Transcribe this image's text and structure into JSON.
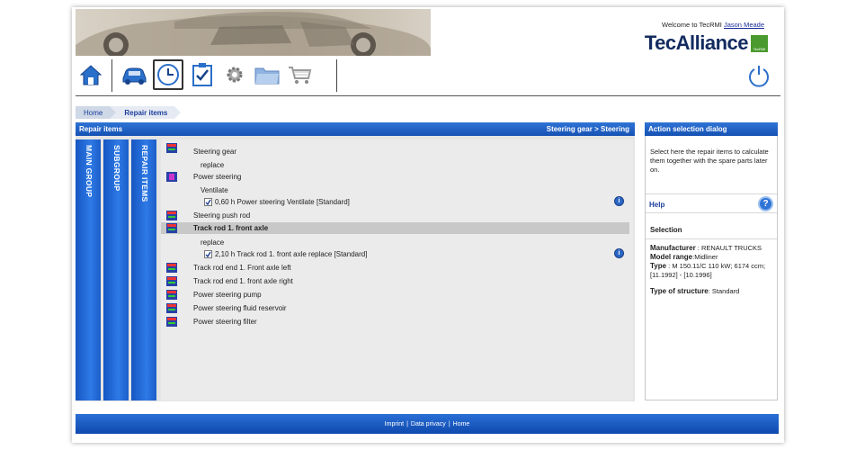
{
  "header": {
    "welcome_prefix": "Welcome to TecRMI",
    "user_name": "Jason Meade",
    "brand": "TecAlliance",
    "brand_mark": "TecRMI"
  },
  "toolbar": {
    "icons": [
      "home-icon",
      "car-icon",
      "clock-icon",
      "checklist-icon",
      "gear-icon",
      "folder-icon",
      "cart-icon"
    ],
    "power_icon": "power-icon"
  },
  "breadcrumb": {
    "home": "Home",
    "current": "Repair items"
  },
  "main": {
    "title": "Repair items",
    "path": "Steering gear > Steering",
    "vertical_tabs": [
      "MAIN GROUP",
      "SUBGROUP",
      "REPAIR ITEMS"
    ],
    "rows": [
      {
        "label": "Steering gear"
      },
      {
        "sub": "replace"
      },
      {
        "label": "Power steering"
      },
      {
        "sub": "Ventilate"
      },
      {
        "check": "0,60 h Power steering Ventilate [Standard]",
        "checked": true
      },
      {
        "label": "Steering push rod"
      },
      {
        "label": "Track rod 1. front axle",
        "selected": true
      },
      {
        "sub": "replace"
      },
      {
        "check": "2,10 h Track rod 1. front axle replace [Standard]",
        "checked": true
      },
      {
        "label": "Track rod end 1. Front axle left"
      },
      {
        "label": "Track rod end 1. front axle right"
      },
      {
        "label": "Power steering pump"
      },
      {
        "label": "Power steering fluid reservoir"
      },
      {
        "label": "Power steering filter"
      }
    ]
  },
  "side": {
    "title": "Action selection dialog",
    "description": "Select here the repair items to calculate them together with the spare parts later on.",
    "help": "Help",
    "selection_title": "Selection",
    "manufacturer_label": "Manufacturer",
    "manufacturer_value": ": RENAULT TRUCKS",
    "model_label": "Model range",
    "model_value": ":Midliner",
    "type_label": "Type",
    "type_value": ": M 150.11/C 110 kW; 6174 ccm; [11.1992] - [10.1996]",
    "structure_label": "Type of structure",
    "structure_value": ": Standard"
  },
  "footer": {
    "links": [
      "Imprint",
      "Data privacy",
      "Home"
    ],
    "separator": "|"
  },
  "colors": {
    "accent": "#1f5fc4",
    "brand": "#132b60",
    "brand_green": "#4b9a2f"
  }
}
